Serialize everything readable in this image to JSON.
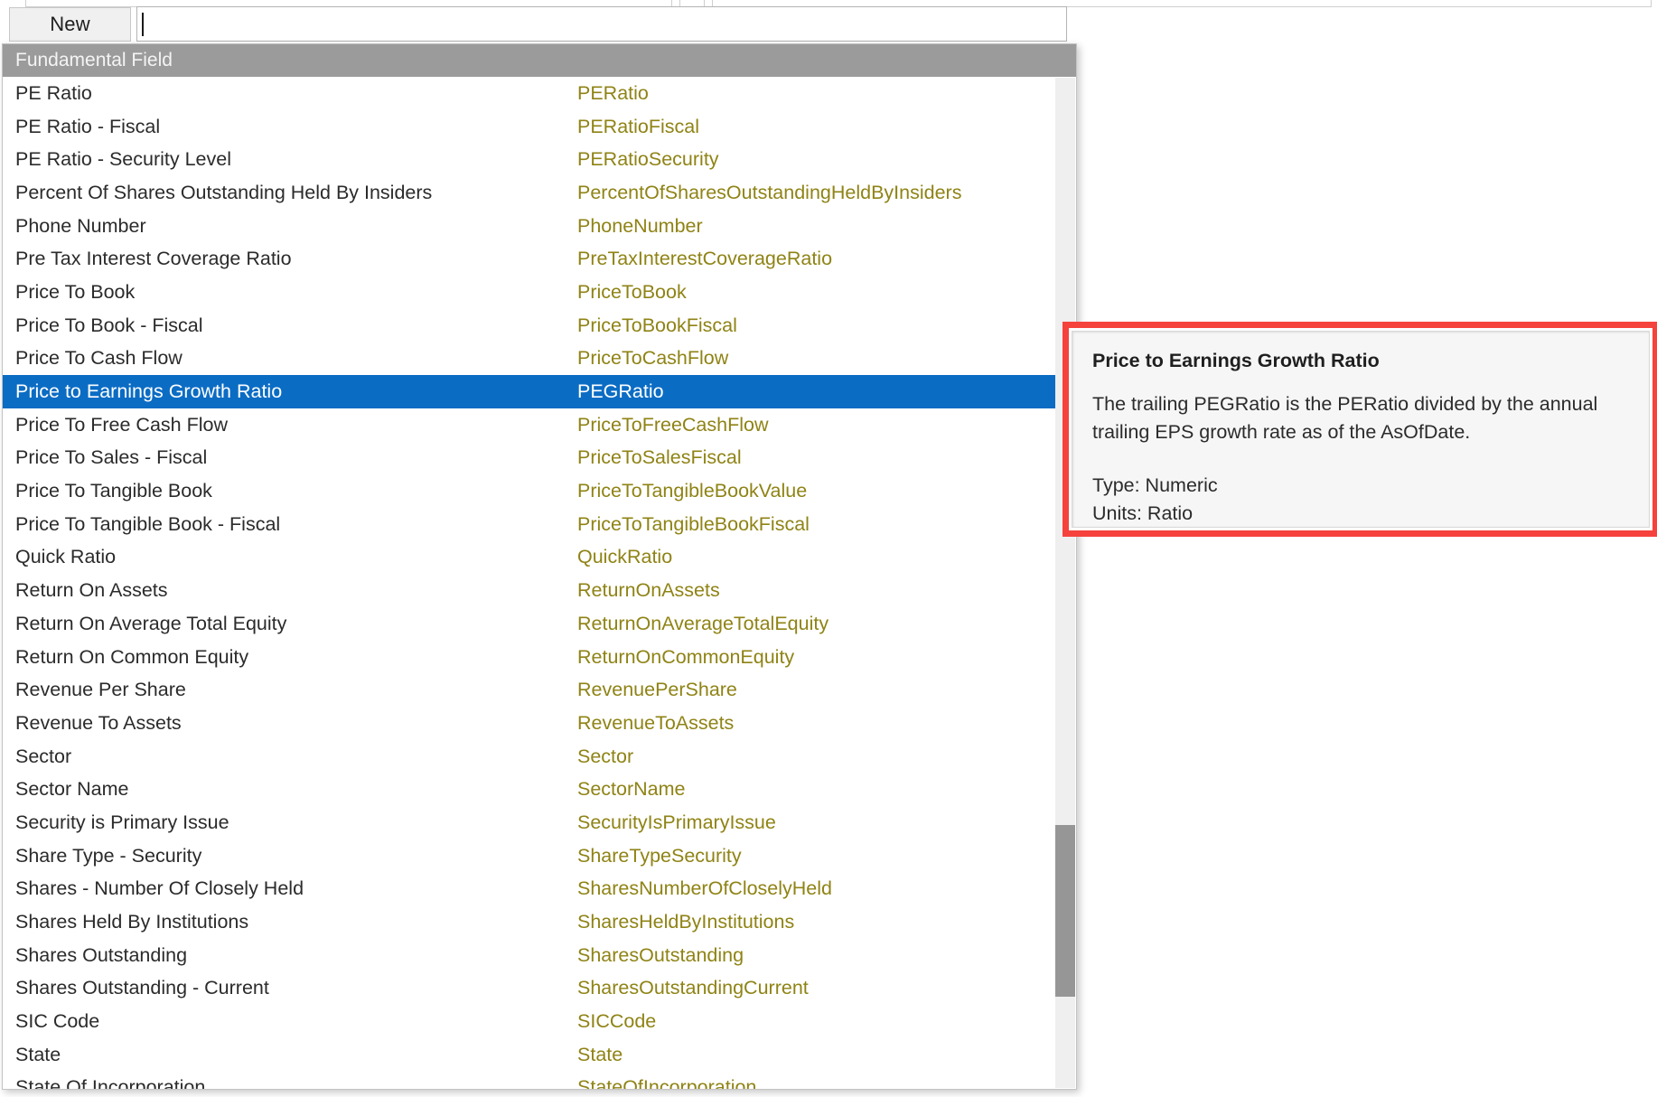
{
  "toolbar": {
    "new_label": "New",
    "search_value": "",
    "search_placeholder": ""
  },
  "list": {
    "header": "Fundamental Field",
    "selected_index": 9,
    "selection_color": "#0b6cc4",
    "code_color": "#8f8315",
    "header_color": "#9b9b9b",
    "rows": [
      {
        "label": "PE Ratio",
        "code": "PERatio"
      },
      {
        "label": "PE Ratio - Fiscal",
        "code": "PERatioFiscal"
      },
      {
        "label": "PE Ratio - Security Level",
        "code": "PERatioSecurity"
      },
      {
        "label": "Percent Of Shares Outstanding Held By Insiders",
        "code": "PercentOfSharesOutstandingHeldByInsiders"
      },
      {
        "label": "Phone Number",
        "code": "PhoneNumber"
      },
      {
        "label": "Pre Tax Interest Coverage Ratio",
        "code": "PreTaxInterestCoverageRatio"
      },
      {
        "label": "Price To Book",
        "code": "PriceToBook"
      },
      {
        "label": "Price To Book - Fiscal",
        "code": "PriceToBookFiscal"
      },
      {
        "label": "Price To Cash Flow",
        "code": "PriceToCashFlow"
      },
      {
        "label": "Price to Earnings Growth Ratio",
        "code": "PEGRatio"
      },
      {
        "label": "Price To Free Cash Flow",
        "code": "PriceToFreeCashFlow"
      },
      {
        "label": "Price To Sales - Fiscal",
        "code": "PriceToSalesFiscal"
      },
      {
        "label": "Price To Tangible Book",
        "code": "PriceToTangibleBookValue"
      },
      {
        "label": "Price To Tangible Book - Fiscal",
        "code": "PriceToTangibleBookFiscal"
      },
      {
        "label": "Quick Ratio",
        "code": "QuickRatio"
      },
      {
        "label": "Return On Assets",
        "code": "ReturnOnAssets"
      },
      {
        "label": "Return On Average Total Equity",
        "code": "ReturnOnAverageTotalEquity"
      },
      {
        "label": "Return On Common Equity",
        "code": "ReturnOnCommonEquity"
      },
      {
        "label": "Revenue Per Share",
        "code": "RevenuePerShare"
      },
      {
        "label": "Revenue To Assets",
        "code": "RevenueToAssets"
      },
      {
        "label": "Sector",
        "code": "Sector"
      },
      {
        "label": "Sector Name",
        "code": "SectorName"
      },
      {
        "label": "Security is Primary Issue",
        "code": "SecurityIsPrimaryIssue"
      },
      {
        "label": "Share Type - Security",
        "code": "ShareTypeSecurity"
      },
      {
        "label": "Shares - Number Of Closely Held",
        "code": "SharesNumberOfCloselyHeld"
      },
      {
        "label": "Shares Held By Institutions",
        "code": "SharesHeldByInstitutions"
      },
      {
        "label": "Shares Outstanding",
        "code": "SharesOutstanding"
      },
      {
        "label": "Shares Outstanding - Current",
        "code": "SharesOutstandingCurrent"
      },
      {
        "label": "SIC Code",
        "code": "SICCode"
      },
      {
        "label": "State",
        "code": "State"
      },
      {
        "label": "State Of Incorporation",
        "code": "StateOfIncorporation"
      }
    ]
  },
  "tooltip": {
    "title": "Price to Earnings Growth Ratio",
    "body": "The trailing PEGRatio is the PERatio divided by the annual trailing EPS growth rate as of the AsOfDate.",
    "type_line": "Type: Numeric",
    "units_line": "Units: Ratio",
    "highlight_color": "#f6423c"
  }
}
